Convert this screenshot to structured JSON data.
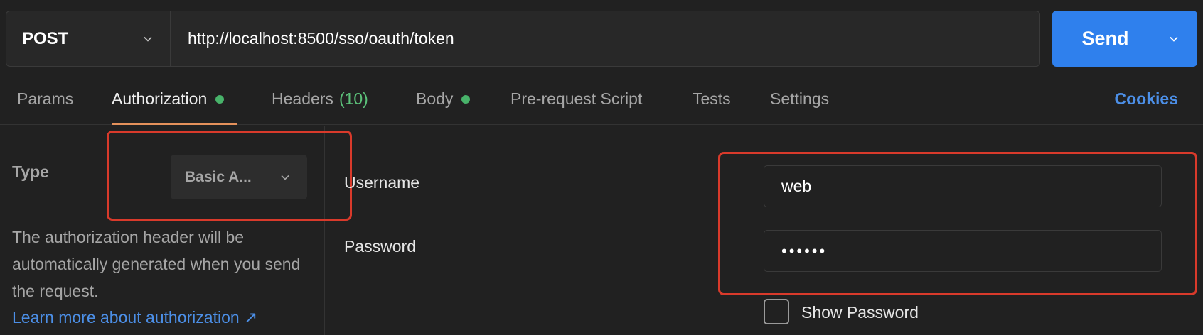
{
  "request": {
    "method": "POST",
    "url": "http://localhost:8500/sso/oauth/token",
    "send_label": "Send"
  },
  "tabs": {
    "params": "Params",
    "authorization": "Authorization",
    "headers": "Headers",
    "headers_count": "(10)",
    "body": "Body",
    "prerequest": "Pre-request Script",
    "tests": "Tests",
    "settings": "Settings",
    "cookies": "Cookies"
  },
  "auth": {
    "type_label": "Type",
    "type_value": "Basic A...",
    "description": "The authorization header will be automatically generated when you send the request.",
    "learn_more": "Learn more about authorization ↗",
    "username_label": "Username",
    "username_value": "web",
    "password_label": "Password",
    "password_value": "••••••",
    "show_password_label": "Show Password",
    "show_password_checked": false
  },
  "colors": {
    "accent": "#2f80ed",
    "active_tab_underline": "#e4915b",
    "status_dot": "#48b36a",
    "link": "#4c8fe7",
    "annotation_box": "#d93a2b"
  },
  "icons": {
    "method_dropdown": "chevron-down-icon",
    "send_dropdown": "chevron-down-icon",
    "type_dropdown": "chevron-down-icon",
    "learn_more": "external-link-icon"
  }
}
